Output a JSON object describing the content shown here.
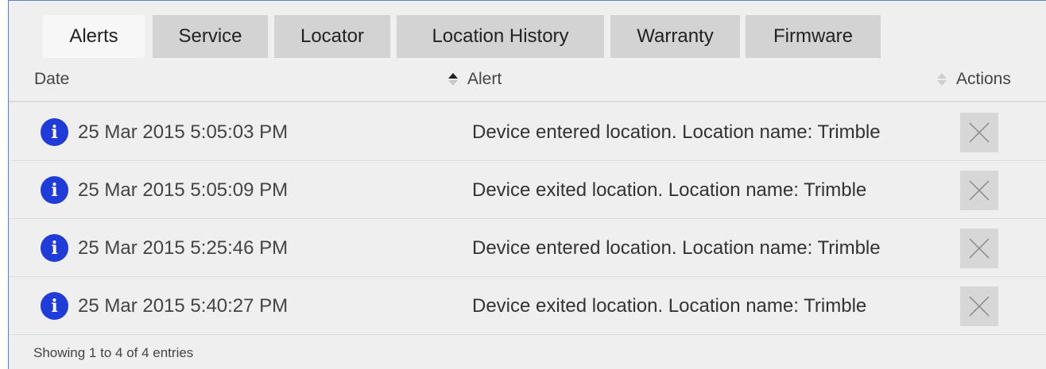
{
  "tabs": [
    {
      "label": "Alerts",
      "active": true
    },
    {
      "label": "Service",
      "active": false
    },
    {
      "label": "Locator",
      "active": false
    },
    {
      "label": "Location History",
      "active": false
    },
    {
      "label": "Warranty",
      "active": false
    },
    {
      "label": "Firmware",
      "active": false
    }
  ],
  "table": {
    "columns": {
      "date": "Date",
      "alert": "Alert",
      "actions": "Actions"
    },
    "sort": {
      "column": "alert",
      "direction": "ascending"
    },
    "rows": [
      {
        "icon": "info-icon",
        "date": "25 Mar 2015 5:05:03 PM",
        "alert": "Device entered location. Location name: Trimble"
      },
      {
        "icon": "info-icon",
        "date": "25 Mar 2015 5:05:09 PM",
        "alert": "Device exited location. Location name: Trimble"
      },
      {
        "icon": "info-icon",
        "date": "25 Mar 2015 5:25:46 PM",
        "alert": "Device entered location. Location name: Trimble"
      },
      {
        "icon": "info-icon",
        "date": "25 Mar 2015 5:40:27 PM",
        "alert": "Device exited location. Location name: Trimble"
      }
    ],
    "info_glyph": "i"
  },
  "footer": {
    "entries_text": "Showing 1 to 4 of 4 entries"
  },
  "colors": {
    "info_icon": "#1f3bd8",
    "panel_background": "#efefef",
    "active_tab": "#f7f7f7",
    "inactive_tab": "#d3d3d3",
    "border_accent": "#5b82c7"
  }
}
